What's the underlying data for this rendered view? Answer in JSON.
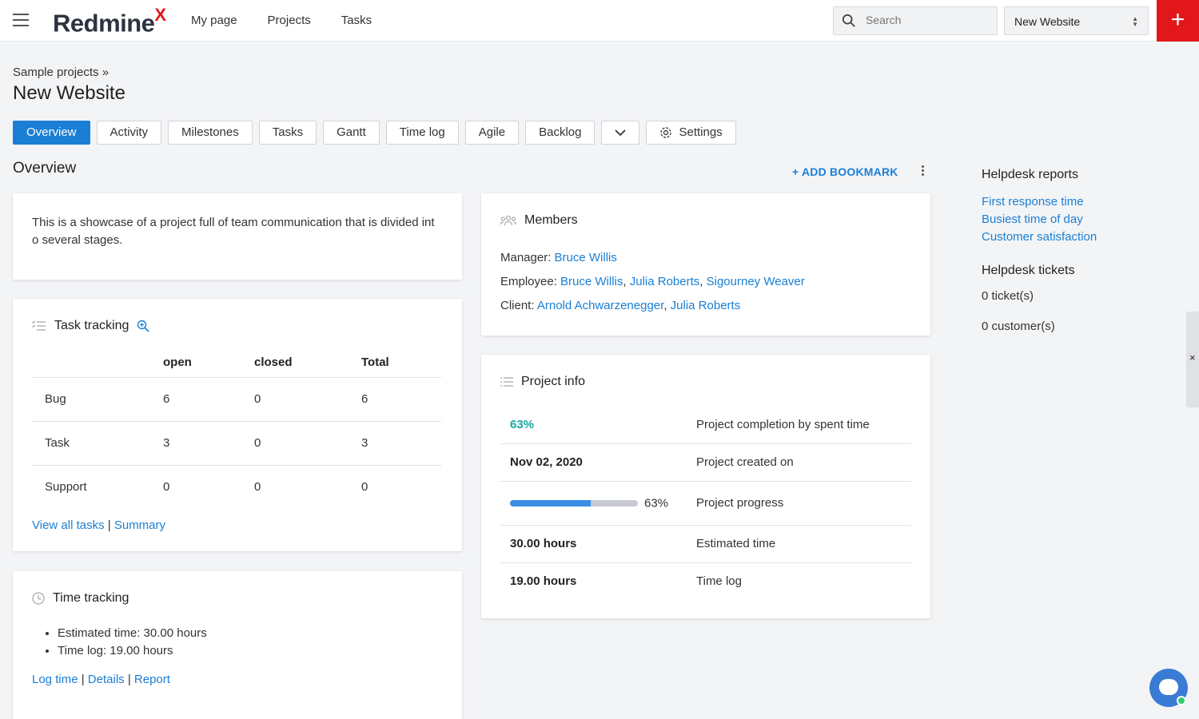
{
  "topbar": {
    "logo_text": "Redmine",
    "logo_mark": "X",
    "nav": [
      "My page",
      "Projects",
      "Tasks"
    ],
    "search_placeholder": "Search",
    "project_select": "New Website",
    "plus_label": "+"
  },
  "breadcrumb": "Sample projects »",
  "title": "New Website",
  "tabs": [
    "Overview",
    "Activity",
    "Milestones",
    "Tasks",
    "Gantt",
    "Time log",
    "Agile",
    "Backlog",
    "",
    "Settings"
  ],
  "overview": {
    "heading": "Overview",
    "add_bookmark": "ADD BOOKMARK"
  },
  "description": "This is a showcase of a project full of team communication that is divided int o several stages.",
  "task_tracking": {
    "title": "Task tracking",
    "columns": [
      "",
      "open",
      "closed",
      "Total"
    ],
    "rows": [
      [
        "Bug",
        "6",
        "0",
        "6"
      ],
      [
        "Task",
        "3",
        "0",
        "3"
      ],
      [
        "Support",
        "0",
        "0",
        "0"
      ]
    ],
    "link_all": "View all tasks",
    "separator": "|",
    "link_summary": "Summary"
  },
  "time_tracking": {
    "title": "Time tracking",
    "items": [
      "Estimated time: 30.00 hours",
      "Time log: 19.00 hours"
    ],
    "link_log": "Log time",
    "link_details": "Details",
    "link_report": "Report",
    "separator": "|"
  },
  "members": {
    "title": "Members",
    "manager_label": "Manager:",
    "manager": "Bruce Willis",
    "employee_label": "Employee:",
    "employees": [
      "Bruce Willis",
      "Julia Roberts",
      "Sigourney Weaver"
    ],
    "client_label": "Client:",
    "clients": [
      "Arnold Achwarzenegger",
      "Julia Roberts"
    ],
    "comma": ","
  },
  "project_info": {
    "title": "Project info",
    "completion_value": "63%",
    "completion_label": "Project completion by spent time",
    "created_value": "Nov 02, 2020",
    "created_label": "Project created on",
    "progress_fraction": 0.63,
    "progress_text": "63%",
    "progress_label": "Project progress",
    "estimated_value": "30.00 hours",
    "estimated_label": "Estimated time",
    "timelog_value": "19.00 hours",
    "timelog_label": "Time log"
  },
  "helpdesk": {
    "reports_title": "Helpdesk reports",
    "reports": [
      "First response time",
      "Busiest time of day",
      "Customer satisfaction"
    ],
    "tickets_title": "Helpdesk tickets",
    "tickets": "0 ticket(s)",
    "customers": "0 customer(s)"
  },
  "side_tab_close": "×",
  "colors": {
    "accent": "#1a7fd4",
    "brand_red": "#e3171b",
    "progress_fill": "#3a8ee6",
    "completion_green": "#15a8a0"
  }
}
